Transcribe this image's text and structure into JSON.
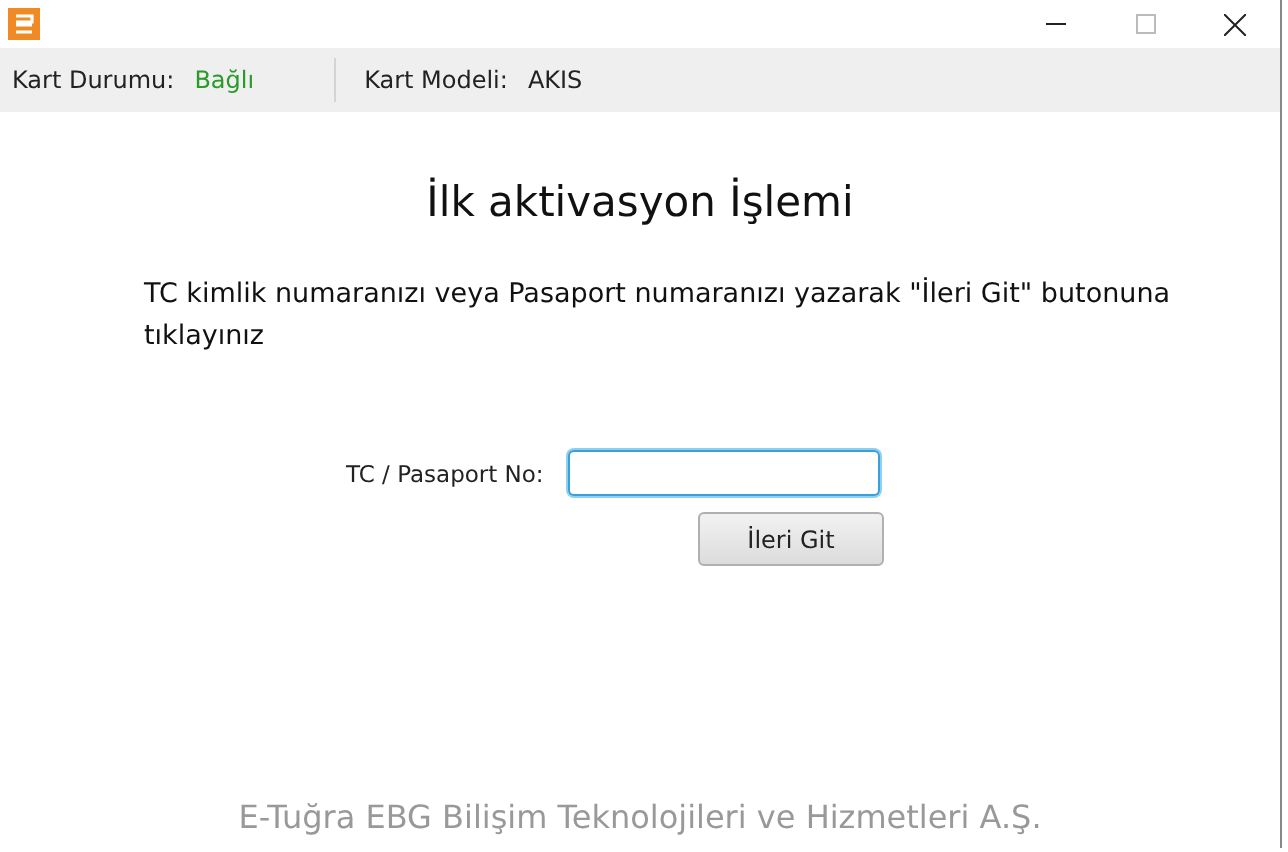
{
  "status_bar": {
    "card_status_label": "Kart Durumu:",
    "card_status_value": "Bağlı",
    "card_model_label": "Kart Modeli:",
    "card_model_value": "AKIS"
  },
  "heading": "İlk aktivasyon İşlemi",
  "instructions": "TC kimlik numaranızı veya Pasaport numaranızı yazarak \"İleri Git\" butonuna tıklayınız",
  "form": {
    "label": "TC / Pasaport No:",
    "focused": true
  },
  "next_button": "İleri Git",
  "footer": "E-Tuğra EBG Bilişim Teknolojileri ve Hizmetleri A.Ş."
}
